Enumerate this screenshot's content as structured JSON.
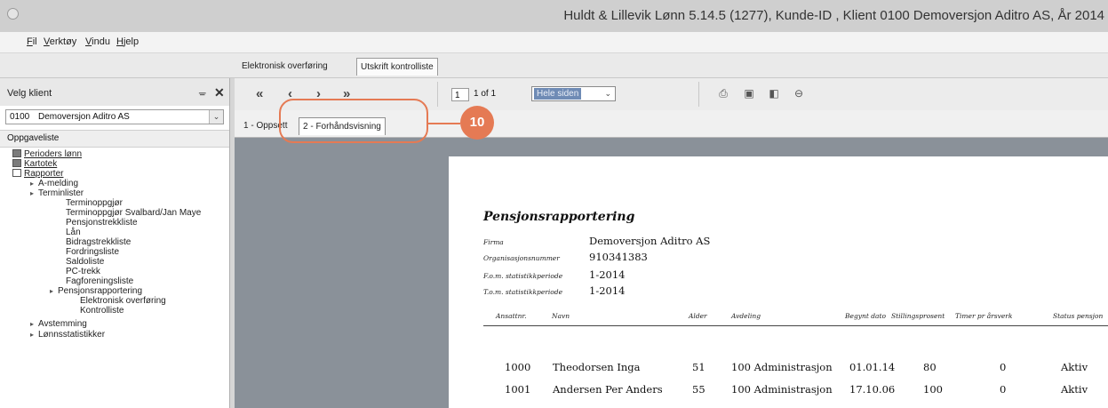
{
  "window": {
    "title": "Huldt & Lillevik Lønn 5.14.5 (1277), Kunde-ID , Klient 0100 Demoversjon Aditro AS, År 2014"
  },
  "menu": [
    {
      "label": "Fil",
      "ul": "F",
      "rest": "il"
    },
    {
      "label": "Verktøy",
      "ul": "V",
      "rest": "erktøy"
    },
    {
      "label": "Vindu",
      "ul": "V",
      "rest": "indu"
    },
    {
      "label": "Hjelp",
      "ul": "H",
      "rest": "jelp"
    }
  ],
  "module_tabs": [
    "Elektronisk overføring",
    "Utskrift kontrolliste"
  ],
  "left_panel": {
    "title": "Velg klient",
    "pin": "ᚚ",
    "close": "✕",
    "client_code": "0100",
    "client_name": "Demoversjon Aditro AS",
    "task_list_label": "Oppgaveliste",
    "tree": [
      "Perioders lønn",
      "Kartotek",
      "Rapporter",
      "A-melding",
      "Terminlister",
      "Terminoppgjør",
      "Terminoppgjør Svalbard/Jan Maye",
      "Pensjonstrekkliste",
      "Lån",
      "Bidragstrekkliste",
      "Fordringsliste",
      "Saldoliste",
      "PC-trekk",
      "Fagforeningsliste",
      "Pensjonsrapportering",
      "Elektronisk overføring",
      "Kontrolliste",
      "Avstemming",
      "Lønnsstatistikker"
    ]
  },
  "toolbar": {
    "first": "«",
    "prev": "‹",
    "next": "›",
    "last": "»",
    "page": "1",
    "of": "1 of 1",
    "zoom": "Hele siden"
  },
  "doc_tabs": [
    "1 - Oppsett",
    "2 - Forhåndsvisning"
  ],
  "callout": {
    "number": "10"
  },
  "report": {
    "title": "Pensjonsrapportering",
    "meta": [
      {
        "label": "Firma",
        "value": "Demoversjon Aditro AS"
      },
      {
        "label": "Organisasjonsnummer",
        "value": "910341383"
      },
      {
        "label": "F.o.m. statistikkperiode",
        "value": "1-2014"
      },
      {
        "label": "T.o.m. statistikkperiode",
        "value": "1-2014"
      }
    ],
    "columns": [
      "Ansattnr.",
      "Navn",
      "Alder",
      "Avdeling",
      "Begynt dato",
      "Stillingsprosent",
      "Timer pr årsverk",
      "Status pensjon"
    ],
    "rows": [
      [
        "1000",
        "Theodorsen Inga",
        "51",
        "100 Administrasjon",
        "01.01.14",
        "80",
        "0",
        "Aktiv"
      ],
      [
        "1001",
        "Andersen Per Anders",
        "55",
        "100 Administrasjon",
        "17.10.06",
        "100",
        "0",
        "Aktiv"
      ]
    ]
  }
}
